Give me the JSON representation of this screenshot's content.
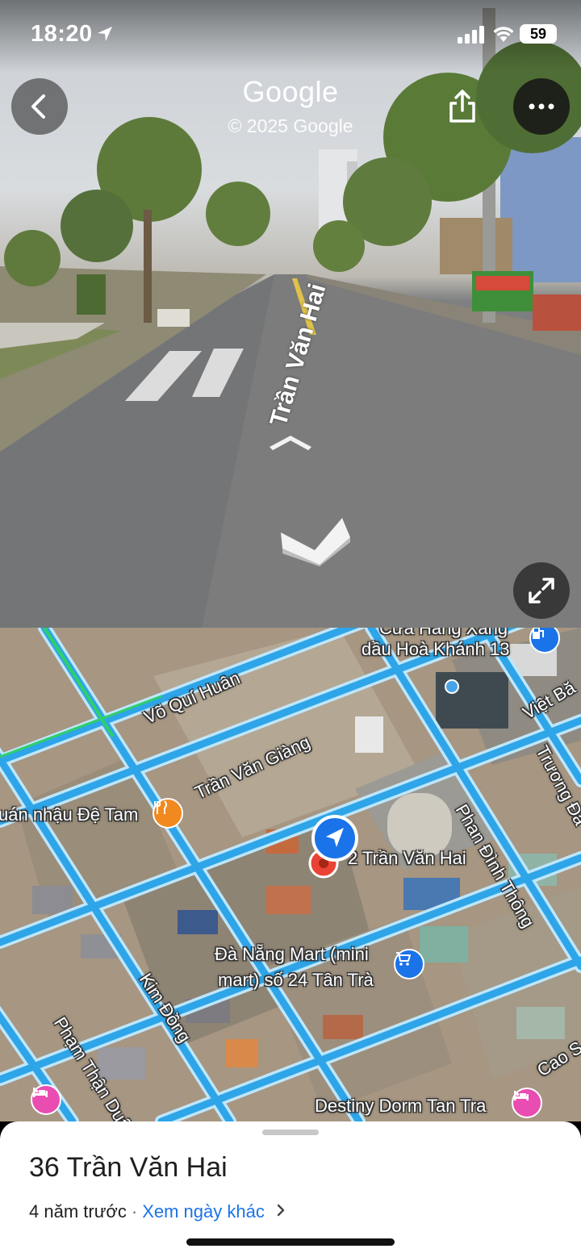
{
  "status_bar": {
    "time": "18:20",
    "battery": "59"
  },
  "street_view": {
    "brand": "Google",
    "copyright": "© 2025 Google",
    "street_label": "Trần Văn Hai"
  },
  "map": {
    "streets": {
      "vo_qui_huan": "Võ Quí Huân",
      "tran_van_giang": "Trần Văn Giàng",
      "kim_dong": "Kim Đồng",
      "pham_than_duat": "Phạm Thận Duật",
      "phan_dinh_thong": "Phan Đình Thông",
      "truong_da": "Trương Đă",
      "viet_ba": "Việt Bă",
      "cao_s": "Cao S"
    },
    "places": {
      "gas_station_line1": "Cửa Hàng Xăng",
      "gas_station_line2": "dầu Hoà Khánh 13",
      "pub": "uán nhậu Đệ Tam",
      "current_address": "2 Trần Văn Hai",
      "mart_line1": "Đà Nẵng Mart (mini",
      "mart_line2": "mart) số 24 Tân Trà",
      "dorm": "Destiny Dorm Tan Tra"
    },
    "icons": [
      "restaurant-icon",
      "cart-icon",
      "gas-station-icon",
      "hotel-icon",
      "navigation-arrow-icon",
      "location-pin-icon"
    ],
    "colors": {
      "road": "#29a3e6",
      "pin": "#ea4335",
      "poi_hotel": "#e94db1",
      "poi_food": "#f2891f",
      "poi_shop": "#1a73e8"
    }
  },
  "sheet": {
    "title": "36 Trần Văn Hai",
    "age": "4 năm trước",
    "separator": "·",
    "other_dates_link": "Xem ngày khác"
  }
}
